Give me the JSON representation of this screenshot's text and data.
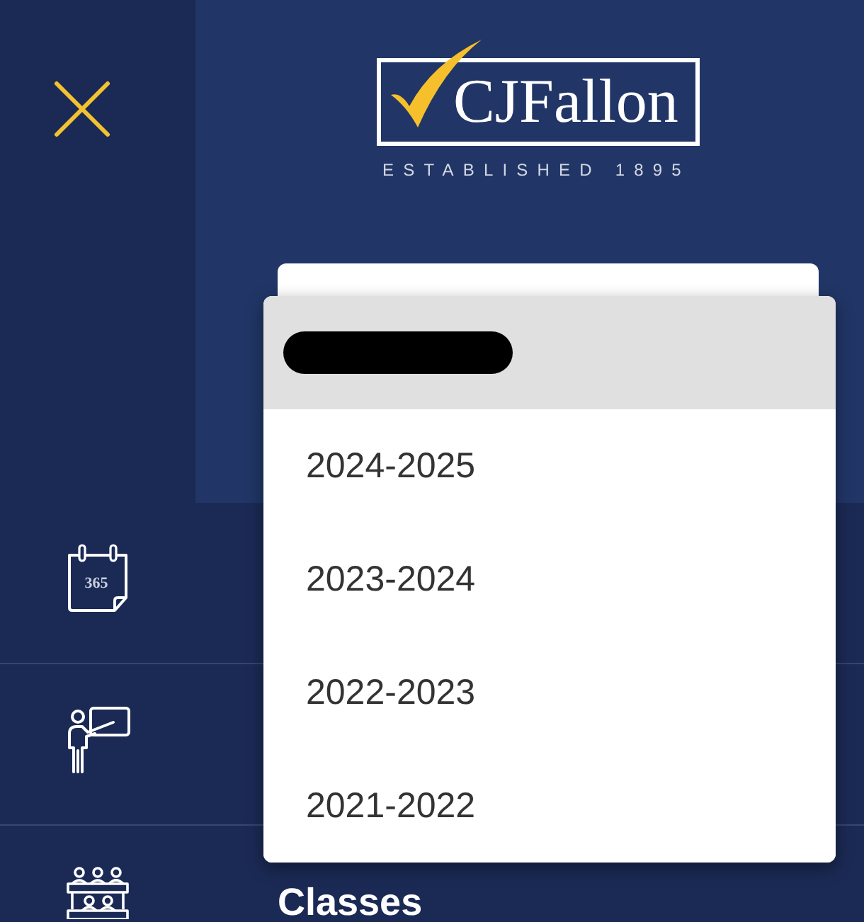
{
  "logo": {
    "wordmark": "CJFallon",
    "tagline": "ESTABLISHED 1895"
  },
  "school_year_select": {
    "options": [
      {
        "kind": "redacted",
        "selected": true
      },
      {
        "kind": "text",
        "label": "2024-2025",
        "selected": false
      },
      {
        "kind": "text",
        "label": "2023-2024",
        "selected": false
      },
      {
        "kind": "text",
        "label": "2022-2023",
        "selected": false
      },
      {
        "kind": "text",
        "label": "2021-2022",
        "selected": false
      }
    ]
  },
  "nav_items": [
    {
      "kind": "calendar",
      "icon_text": "365"
    },
    {
      "kind": "teacher"
    },
    {
      "kind": "classroom",
      "label": "Classes"
    }
  ]
}
